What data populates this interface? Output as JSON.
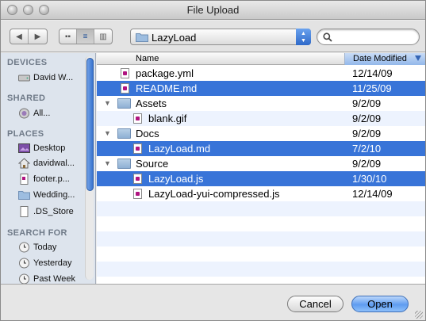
{
  "window": {
    "title": "File Upload"
  },
  "toolbar": {
    "back_label": "◀",
    "forward_label": "▶",
    "view_icons": "▪▪",
    "view_list": "≡",
    "view_columns": "▥",
    "location": "LazyLoad",
    "search_placeholder": ""
  },
  "sidebar": {
    "sections": [
      {
        "header": "DEVICES",
        "items": [
          {
            "label": "David W...",
            "icon": "hard-drive-icon"
          }
        ]
      },
      {
        "header": "SHARED",
        "items": [
          {
            "label": "All...",
            "icon": "shared-network-icon"
          }
        ]
      },
      {
        "header": "PLACES",
        "items": [
          {
            "label": "Desktop",
            "icon": "desktop-icon"
          },
          {
            "label": "davidwal...",
            "icon": "home-icon"
          },
          {
            "label": "footer.p...",
            "icon": "document-icon"
          },
          {
            "label": "Wedding...",
            "icon": "folder-icon"
          },
          {
            "label": ".DS_Store",
            "icon": "document-icon"
          }
        ]
      },
      {
        "header": "SEARCH FOR",
        "items": [
          {
            "label": "Today",
            "icon": "clock-icon"
          },
          {
            "label": "Yesterday",
            "icon": "clock-icon"
          },
          {
            "label": "Past Week",
            "icon": "clock-icon"
          }
        ]
      }
    ]
  },
  "list": {
    "columns": {
      "name": "Name",
      "date": "Date Modified"
    },
    "rows": [
      {
        "name": "package.yml",
        "date": "12/14/09",
        "kind": "file",
        "depth": 0,
        "selected": false
      },
      {
        "name": "README.md",
        "date": "11/25/09",
        "kind": "file",
        "depth": 0,
        "selected": true
      },
      {
        "name": "Assets",
        "date": "9/2/09",
        "kind": "folder",
        "depth": 0,
        "selected": false
      },
      {
        "name": "blank.gif",
        "date": "9/2/09",
        "kind": "file",
        "depth": 1,
        "selected": false
      },
      {
        "name": "Docs",
        "date": "9/2/09",
        "kind": "folder",
        "depth": 0,
        "selected": false
      },
      {
        "name": "LazyLoad.md",
        "date": "7/2/10",
        "kind": "file",
        "depth": 1,
        "selected": true
      },
      {
        "name": "Source",
        "date": "9/2/09",
        "kind": "folder",
        "depth": 0,
        "selected": false
      },
      {
        "name": "LazyLoad.js",
        "date": "1/30/10",
        "kind": "file",
        "depth": 1,
        "selected": true
      },
      {
        "name": "LazyLoad-yui-compressed.js",
        "date": "12/14/09",
        "kind": "file",
        "depth": 1,
        "selected": false
      }
    ]
  },
  "buttons": {
    "cancel": "Cancel",
    "open": "Open"
  },
  "colors": {
    "selection": "#3874d8",
    "accent": "#5e9cf0"
  }
}
